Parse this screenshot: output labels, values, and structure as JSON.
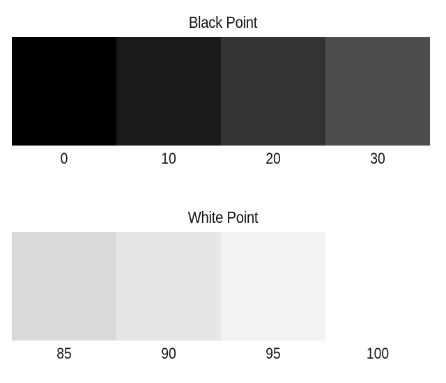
{
  "chart_data": [
    {
      "type": "heatmap",
      "title": "Black Point",
      "categories": [
        "0",
        "10",
        "20",
        "30"
      ],
      "values": [
        0,
        10,
        20,
        30
      ],
      "colors": [
        "#000000",
        "#1a1a1a",
        "#333333",
        "#4d4d4d"
      ],
      "xlabel": "",
      "ylabel": "",
      "grid": false
    },
    {
      "type": "heatmap",
      "title": "White Point",
      "categories": [
        "85",
        "90",
        "95",
        "100"
      ],
      "values": [
        85,
        90,
        95,
        100
      ],
      "colors": [
        "#d9d9d9",
        "#e6e6e6",
        "#f2f2f2",
        "#ffffff"
      ],
      "xlabel": "",
      "ylabel": "",
      "grid": false
    }
  ]
}
